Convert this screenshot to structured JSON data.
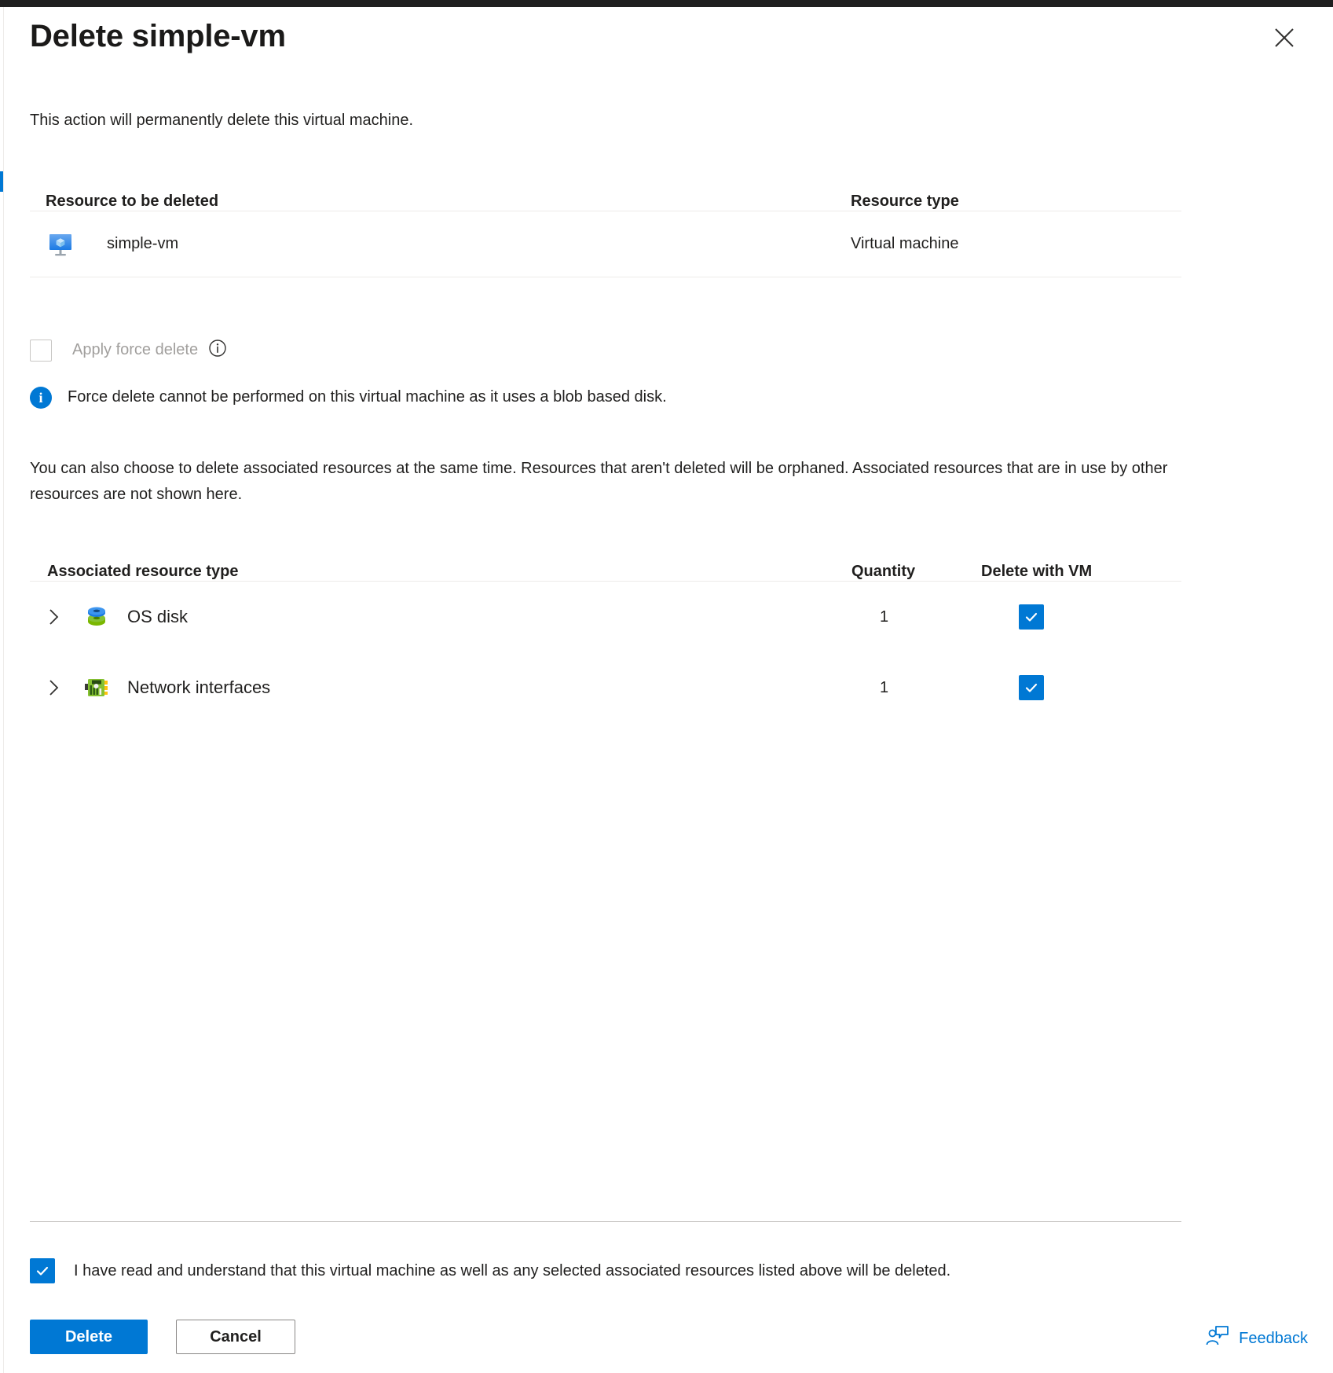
{
  "window": {
    "title": "Delete simple-vm",
    "close_label": "Close"
  },
  "intro": {
    "text": "This action will permanently delete this virtual machine."
  },
  "resource_table": {
    "headers": {
      "name": "Resource to be deleted",
      "type": "Resource type"
    },
    "rows": [
      {
        "name": "simple-vm",
        "type": "Virtual machine",
        "icon": "virtual-machine-icon"
      }
    ]
  },
  "force_delete": {
    "label": "Apply force delete",
    "checked": false,
    "disabled": true,
    "info_icon": "info-icon",
    "message": "Force delete cannot be performed on this virtual machine as it uses a blob based disk.",
    "message_icon": "info-filled-icon"
  },
  "associated_note": {
    "text": "You can also choose to delete associated resources at the same time. Resources that aren't deleted will be orphaned. Associated resources that are in use by other resources are not shown here."
  },
  "associated_table": {
    "headers": {
      "type": "Associated resource type",
      "quantity": "Quantity",
      "delete_with_vm": "Delete with VM"
    },
    "rows": [
      {
        "label": "OS disk",
        "quantity": "1",
        "checked": true,
        "icon": "disk-icon",
        "expand_icon": "chevron-right-icon"
      },
      {
        "label": "Network interfaces",
        "quantity": "1",
        "checked": true,
        "icon": "network-interface-icon",
        "expand_icon": "chevron-right-icon"
      }
    ]
  },
  "acknowledgement": {
    "text": "I have read and understand that this virtual machine as well as any selected associated resources listed above will be deleted.",
    "checked": true
  },
  "footer": {
    "delete_label": "Delete",
    "cancel_label": "Cancel",
    "feedback_label": "Feedback",
    "feedback_icon": "feedback-person-icon"
  },
  "colors": {
    "accent": "#0078d4",
    "topbar": "#1f1f1f",
    "text": "#201f1e",
    "disabled_text": "#a19f9d",
    "border": "#edebe9"
  }
}
